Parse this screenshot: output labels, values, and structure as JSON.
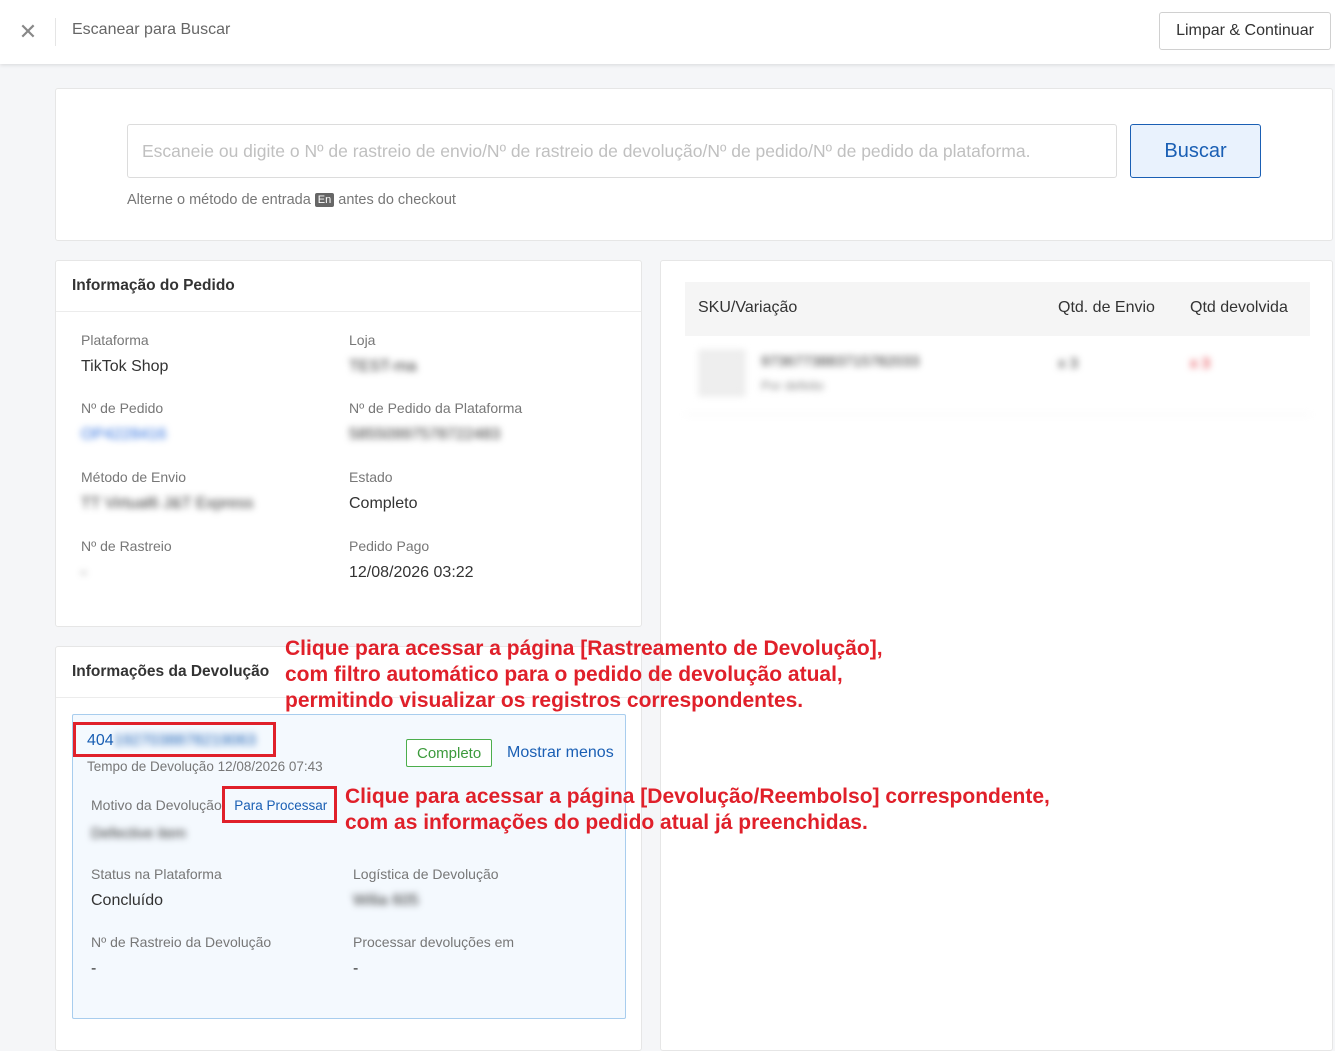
{
  "header": {
    "title": "Escanear para Buscar",
    "clear_button": "Limpar & Continuar"
  },
  "search": {
    "placeholder": "Escaneie ou digite o Nº de rastreio de envio/Nº de rastreio de devolução/Nº de pedido/Nº de pedido da plataforma.",
    "button": "Buscar",
    "hint_before": "Alterne o método de entrada",
    "hint_badge": "En",
    "hint_after": "antes do checkout"
  },
  "order_info": {
    "title": "Informação do Pedido",
    "platform_label": "Plataforma",
    "platform_value": "TikTok Shop",
    "store_label": "Loja",
    "store_value": "TEST-ma",
    "order_no_label": "Nº de Pedido",
    "order_no_value": "OP4228416",
    "platform_order_label": "Nº de Pedido da Plataforma",
    "platform_order_value": "58550997578722483",
    "shipping_label": "Método de Envio",
    "shipping_value": "TT Virtual6 J&T Express",
    "status_label": "Estado",
    "status_value": "Completo",
    "tracking_label": "Nº de Rastreio",
    "tracking_value": "-",
    "paid_label": "Pedido Pago",
    "paid_value": "12/08/2026 03:22"
  },
  "sku_table": {
    "col_sku": "SKU/Variação",
    "col_ship_qty": "Qtd. de Envio",
    "col_returned_qty": "Qtd devolvida",
    "row_sku": "9736773883715782033",
    "row_variant": "Por defeito",
    "row_ship_qty": "x 3",
    "row_returned_qty": "x 3"
  },
  "return_info": {
    "title": "Informações da Devolução",
    "return_no_prefix": "404",
    "return_no_rest": "1927038878219063",
    "status_badge": "Completo",
    "show_less": "Mostrar menos",
    "return_time": "Tempo de Devolução 12/08/2026 07:43",
    "reason_label": "Motivo da Devolução",
    "process_link": "Para Processar",
    "reason_value": "Defective item",
    "platform_status_label": "Status na Plataforma",
    "platform_status_value": "Concluído",
    "logistics_label": "Logística de Devolução",
    "logistics_value": "Wilia 605",
    "return_tracking_label": "Nº de Rastreio da Devolução",
    "return_tracking_value": "-",
    "process_at_label": "Processar devoluções em",
    "process_at_value": "-"
  },
  "annotations": {
    "a1_line1": "Clique para acessar a página [Rastreamento de Devolução],",
    "a1_line2": "com filtro automático para o pedido de devolução atual,",
    "a1_line3": "permitindo visualizar os registros correspondentes.",
    "a2_line1": "Clique para acessar a página [Devolução/Reembolso] correspondente,",
    "a2_line2": "com as informações do pedido atual já preenchidas."
  },
  "colors": {
    "accent": "#1a5fb4",
    "annotation": "#e0202a",
    "success": "#3c9a3c"
  }
}
